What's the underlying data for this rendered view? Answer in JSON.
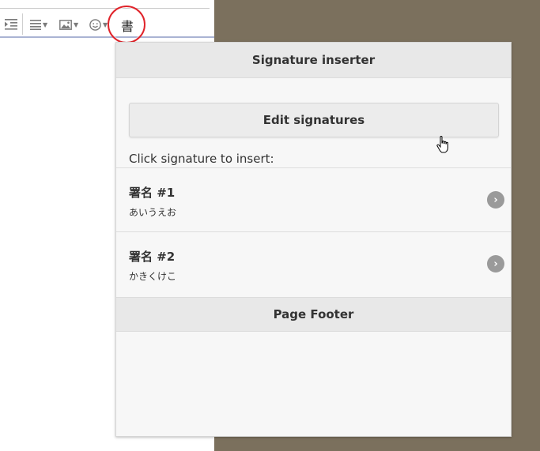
{
  "toolbar": {
    "indent_icon": "indent-icon",
    "align_icon": "align-icon",
    "image_icon": "image-icon",
    "emoji_icon": "emoji-icon",
    "signature_glyph": "書"
  },
  "panel": {
    "title": "Signature inserter",
    "edit_button": "Edit signatures",
    "instruction": "Click signature to insert:",
    "signatures": [
      {
        "name": "署名 #1",
        "preview": "あいうえお"
      },
      {
        "name": "署名 #2",
        "preview": "かきくけこ"
      }
    ],
    "footer": "Page Footer"
  },
  "colors": {
    "highlight_ring": "#e0242b",
    "background": "#7b705d"
  }
}
